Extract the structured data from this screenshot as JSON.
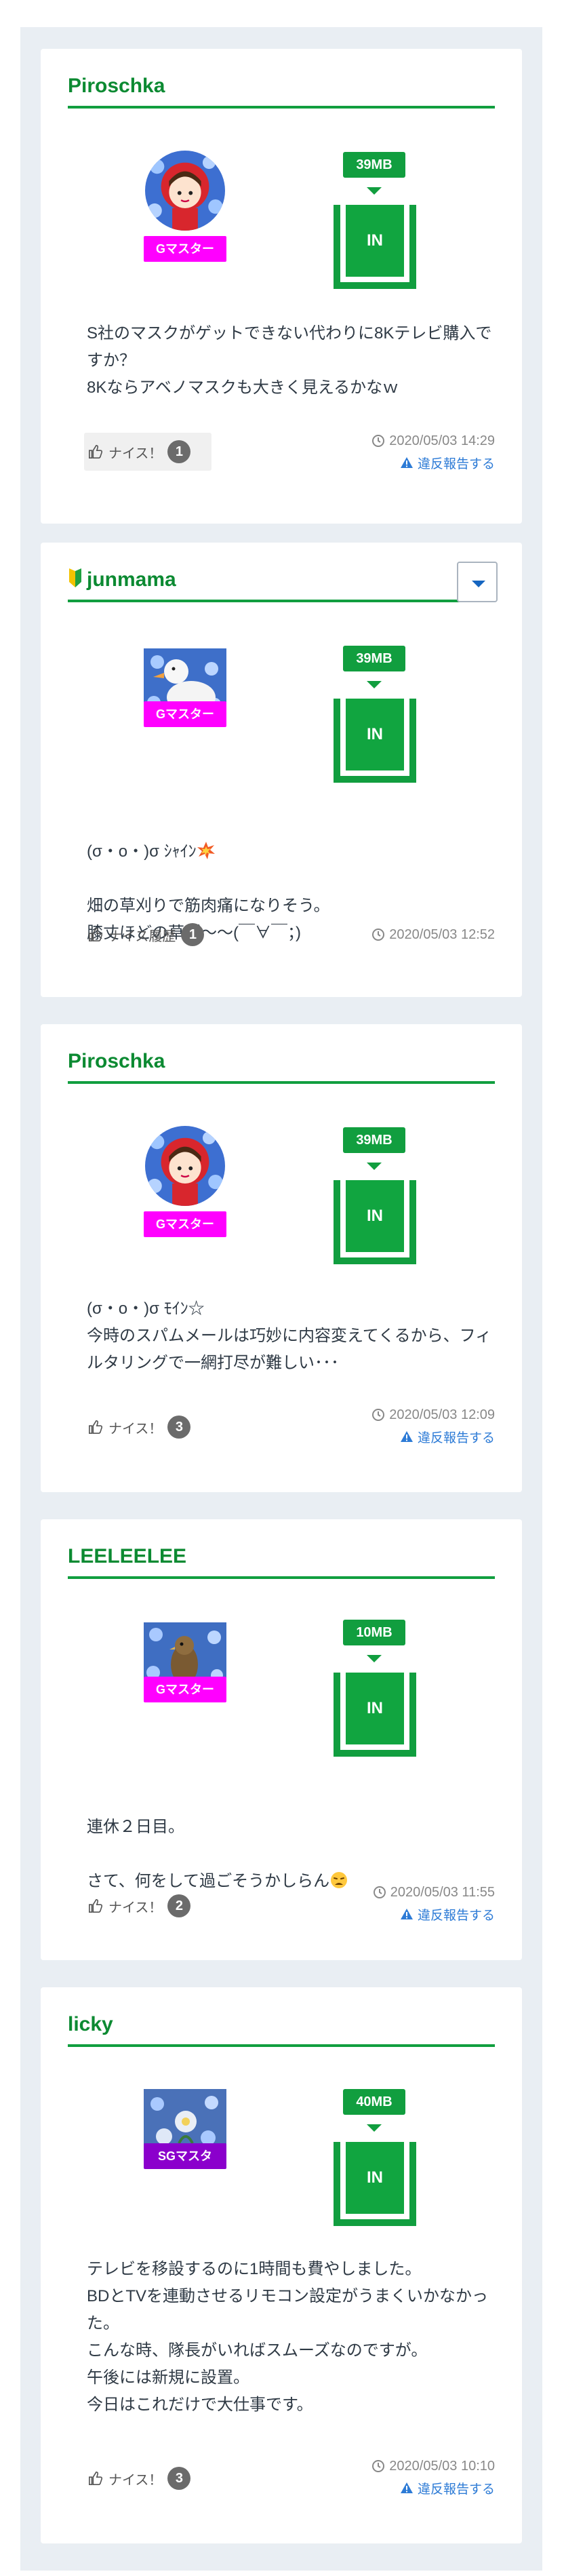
{
  "colors": {
    "accent_green": "#119e3f",
    "username_green": "#0c8a32",
    "badge_magenta": "#ff00ff",
    "badge_purple": "#8b00cc",
    "link_blue": "#2d7bd6",
    "page_bg": "#e9eef3"
  },
  "in_label": "IN",
  "nice_label": "ナイス！",
  "nice_history_label": "ナイス履歴",
  "report_label": "違反報告する",
  "posts": [
    {
      "username": "Piroschka",
      "rank": "Gマスター",
      "data_usage": "39MB",
      "body": "S社のマスクがゲットできない代わりに8Kテレビ購入ですか？\n8Kならアベノマスクも大きく見えるかなｗ",
      "nice_count": "1",
      "timestamp": "2020/05/03 14:29",
      "avatar_icon": "red-hood-avatar-icon"
    },
    {
      "username": "junmama",
      "rank": "Gマスター",
      "data_usage": "39MB",
      "body_line1": "(σ・o・)σ ｼｬｲﾝ",
      "body_rest": "畑の草刈りで筋肉痛になりそう。\n膝丈ほどの草が〜〜(￣∀￣；)",
      "nice_count": "1",
      "timestamp": "2020/05/03 12:52",
      "avatar_icon": "duck-avatar-icon"
    },
    {
      "username": "Piroschka",
      "rank": "Gマスター",
      "data_usage": "39MB",
      "body": "(σ・o・)σ ﾓｲﾝ☆\n今時のスパムメールは巧妙に内容変えてくるから、フィルタリングで一網打尽が難しい･･･",
      "nice_count": "3",
      "timestamp": "2020/05/03 12:09",
      "avatar_icon": "red-hood-avatar-icon"
    },
    {
      "username": "LEELEELEE",
      "rank": "Gマスター",
      "data_usage": "10MB",
      "body_line1": "連休２日目。",
      "body_line2": "さて、何をして過ごそうかしらん",
      "nice_count": "2",
      "timestamp": "2020/05/03 11:55",
      "avatar_icon": "bird-avatar-icon"
    },
    {
      "username": "licky",
      "rank": "SGマスタ",
      "data_usage": "40MB",
      "body": "テレビを移設するのに1時間も費やしました。\nBDとTVを連動させるリモコン設定がうまくいかなかった。\nこんな時、隊長がいればスムーズなのですが。\n午後には新規に設置。\n今日はこれだけで大仕事です。",
      "nice_count": "3",
      "timestamp": "2020/05/03 10:10",
      "avatar_icon": "flower-avatar-icon"
    }
  ]
}
